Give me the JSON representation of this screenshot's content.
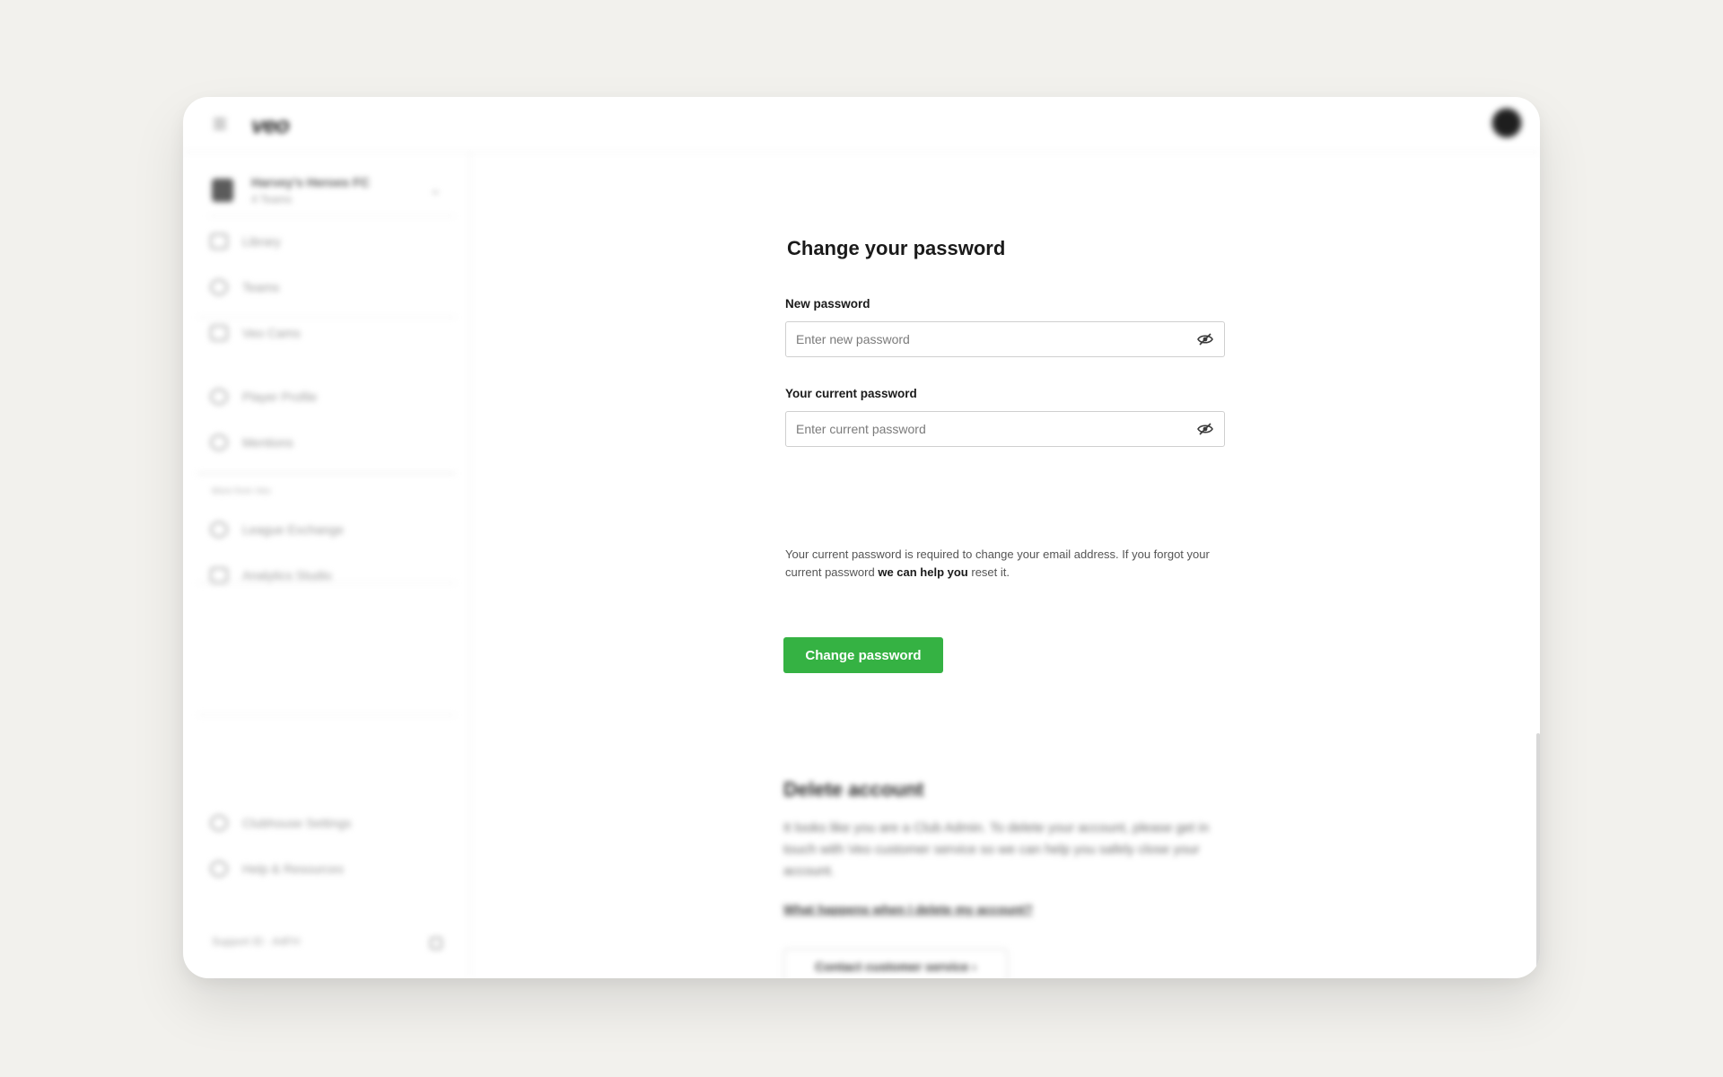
{
  "header": {
    "logo": "veo"
  },
  "sidebar": {
    "club": {
      "name": "Harvey's Heroes FC",
      "sub": "4 Teams"
    },
    "items": [
      {
        "label": "Library",
        "icon": "video-icon"
      },
      {
        "label": "Teams",
        "icon": "people-icon"
      },
      {
        "label": "Veo Cams",
        "icon": "camera-icon"
      },
      {
        "label": "Player Profile",
        "icon": "person-icon"
      },
      {
        "label": "Mentions",
        "icon": "at-icon"
      },
      {
        "label": "League Exchange",
        "icon": "share-icon"
      },
      {
        "label": "Analytics Studio",
        "icon": "chart-icon"
      }
    ],
    "section_label": "More from Veo",
    "bottom_items": [
      {
        "label": "Clubhouse Settings",
        "icon": "gear-icon"
      },
      {
        "label": "Help & Resources",
        "icon": "help-icon"
      }
    ],
    "support": "Support ID · A4FH"
  },
  "form": {
    "title": "Change your password",
    "new_password": {
      "label": "New password",
      "placeholder": "Enter new password",
      "value": ""
    },
    "current_password": {
      "label": "Your current password",
      "placeholder": "Enter current password",
      "value": ""
    },
    "help_text_before": "Your current password is required to change your email address. If you forgot your current password ",
    "help_link": "we can help you",
    "help_text_after": " reset it.",
    "submit_label": "Change password"
  },
  "delete_account": {
    "title": "Delete account",
    "text": "It looks like you are a Club Admin. To delete your account, please get in touch with Veo customer service so we can help you safely close your account.",
    "link": "What happens when I delete my account?",
    "button": "Contact customer service ›"
  },
  "colors": {
    "page_bg": "#f2f1ed",
    "primary": "#35b243"
  }
}
